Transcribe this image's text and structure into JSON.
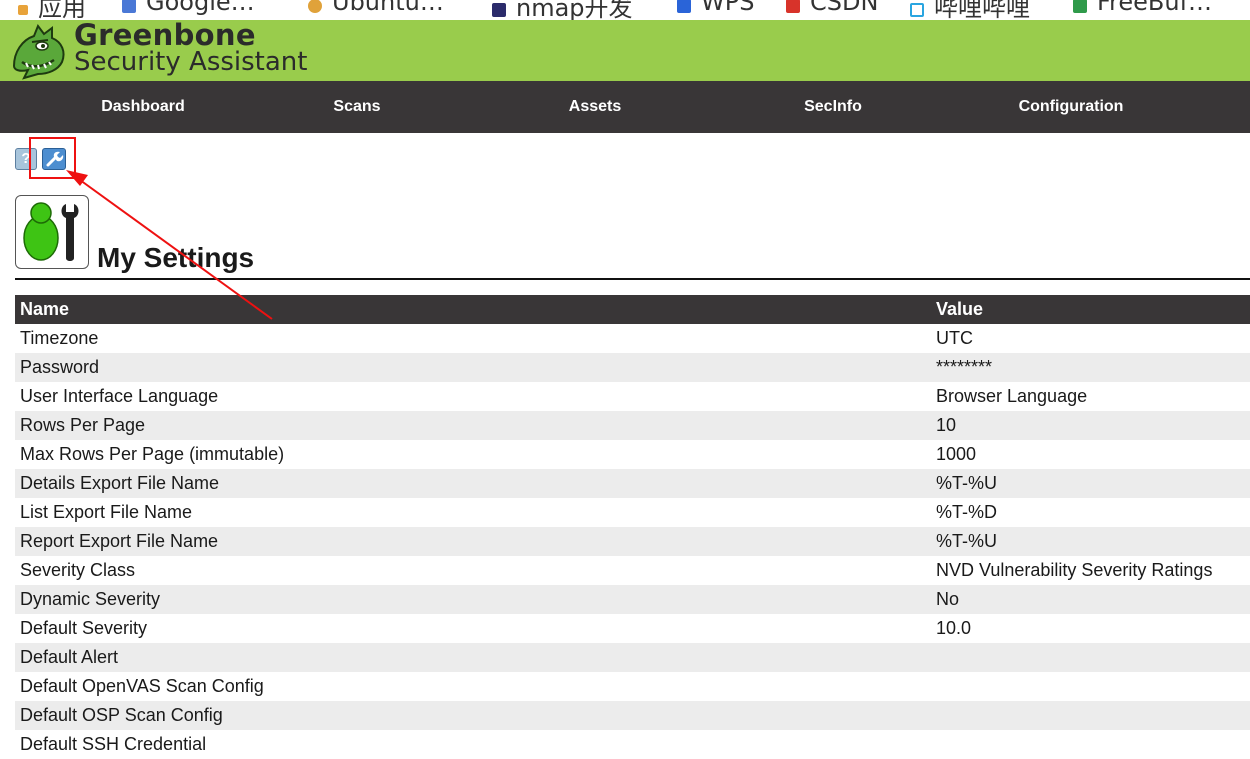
{
  "bookmarks": [
    {
      "label": "应用",
      "icon": "apps-grid-icon",
      "color": "#e8a33a"
    },
    {
      "label": "Google…",
      "icon": "google-icon",
      "color": "#4a78d6"
    },
    {
      "label": "Ubuntu…",
      "icon": "ubuntu-icon",
      "color": "#e0a23a"
    },
    {
      "label": "nmap开发",
      "icon": "nmap-icon",
      "color": "#2b2b6b"
    },
    {
      "label": "WPS",
      "icon": "wps-icon",
      "color": "#2a64d8"
    },
    {
      "label": "CSDN",
      "icon": "csdn-icon",
      "color": "#d8332a"
    },
    {
      "label": "哔哩哔哩",
      "icon": "bilibili-icon",
      "color": "#29a5e0"
    },
    {
      "label": "FreeBuf…",
      "icon": "freebuf-icon",
      "color": "#2f9a4a"
    }
  ],
  "brand": {
    "line1": "Greenbone",
    "line2": "Security Assistant",
    "logo_icon": "greenbone-dinosaur-logo",
    "bg_color": "#99cc4c"
  },
  "nav": {
    "items": [
      "Dashboard",
      "Scans",
      "Assets",
      "SecInfo",
      "Configuration"
    ],
    "bg_color": "#393637"
  },
  "toolbar": {
    "help_icon": "help-icon",
    "help_glyph": "?",
    "edit_icon": "wrench-icon"
  },
  "page": {
    "title": "My Settings",
    "icon": "my-settings-icon"
  },
  "table": {
    "headers": {
      "name": "Name",
      "value": "Value"
    },
    "rows": [
      {
        "name": "Timezone",
        "value": "UTC"
      },
      {
        "name": "Password",
        "value": "********"
      },
      {
        "name": "User Interface Language",
        "value": "Browser Language"
      },
      {
        "name": "Rows Per Page",
        "value": "10"
      },
      {
        "name": "Max Rows Per Page (immutable)",
        "value": "1000"
      },
      {
        "name": "Details Export File Name",
        "value": "%T-%U"
      },
      {
        "name": "List Export File Name",
        "value": "%T-%D"
      },
      {
        "name": "Report Export File Name",
        "value": "%T-%U"
      },
      {
        "name": "Severity Class",
        "value": "NVD Vulnerability Severity Ratings"
      },
      {
        "name": "Dynamic Severity",
        "value": "No"
      },
      {
        "name": "Default Severity",
        "value": "10.0"
      },
      {
        "name": "Default Alert",
        "value": ""
      },
      {
        "name": "Default OpenVAS Scan Config",
        "value": ""
      },
      {
        "name": "Default OSP Scan Config",
        "value": ""
      },
      {
        "name": "Default SSH Credential",
        "value": ""
      }
    ]
  },
  "annotation": {
    "color": "#ee1111"
  }
}
